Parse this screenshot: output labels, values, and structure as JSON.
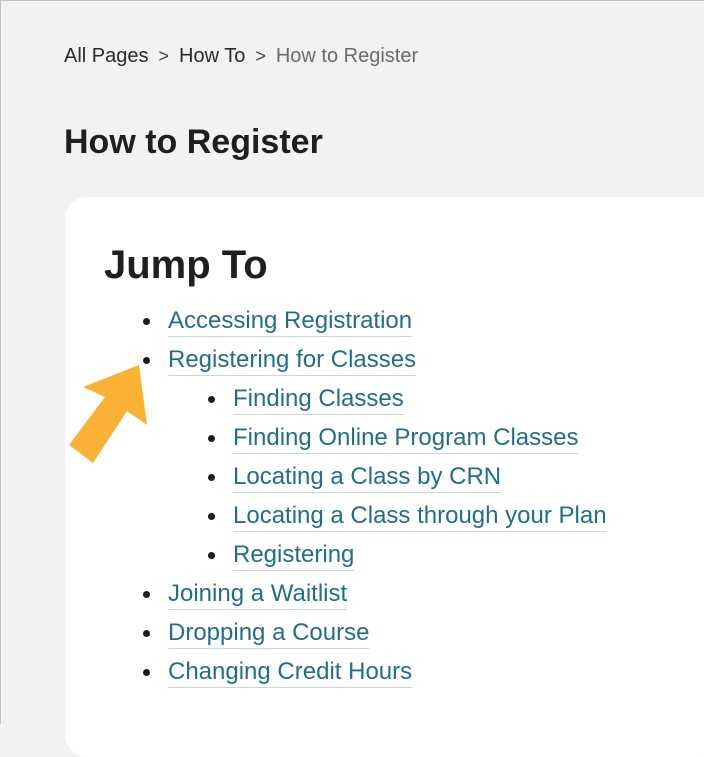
{
  "breadcrumb": {
    "items": [
      "All Pages",
      "How To",
      "How to Register"
    ],
    "separator": ">"
  },
  "page_title": "How to Register",
  "jump_to": {
    "title": "Jump To",
    "links": [
      {
        "label": "Accessing Registration",
        "level": 1
      },
      {
        "label": "Registering for Classes",
        "level": 1
      },
      {
        "label": "Finding Classes",
        "level": 2
      },
      {
        "label": "Finding Online Program Classes",
        "level": 2
      },
      {
        "label": "Locating a Class by CRN",
        "level": 2
      },
      {
        "label": "Locating a Class through your Plan",
        "level": 2
      },
      {
        "label": "Registering",
        "level": 2
      },
      {
        "label": "Joining a Waitlist",
        "level": 1
      },
      {
        "label": "Dropping a Course",
        "level": 1
      },
      {
        "label": "Changing Credit Hours",
        "level": 1
      }
    ]
  },
  "colors": {
    "link": "#1f6f8b",
    "arrow": "#f9b234",
    "background": "#f2f2f2",
    "card": "#ffffff"
  },
  "annotation": {
    "icon": "arrow-pointer-icon"
  }
}
